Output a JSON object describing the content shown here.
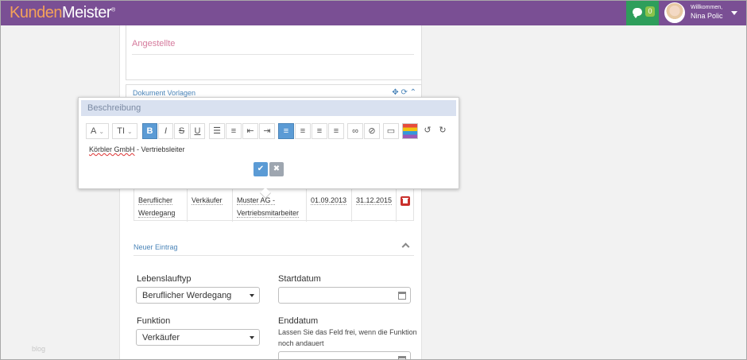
{
  "header": {
    "brand_part1": "Kunden",
    "brand_part2": "Meister",
    "brand_mark": "®",
    "chat_count": "0",
    "welcome": "Willkommen,",
    "username": "Nina Polic"
  },
  "sidebar": {
    "label": "blog"
  },
  "form_top": {
    "field_value": "Angestellte"
  },
  "doc_panel": {
    "title": "Dokument Vorlagen"
  },
  "modal": {
    "title": "Beschreibung",
    "content_company": "Körbler GmbH",
    "content_rest": " - Vertriebsleiter",
    "ok_icon": "✔",
    "cancel_icon": "✖"
  },
  "career_table": {
    "row": {
      "type": "Beruflicher Werdegang",
      "function": "Verkäufer",
      "company": "Muster AG - Vertriebsmitarbeiter",
      "start": "01.09.2013",
      "end": "31.12.2015"
    }
  },
  "new_entry": {
    "title": "Neuer Eintrag",
    "lebenslauftyp_label": "Lebenslauftyp",
    "lebenslauftyp_value": "Beruflicher Werdegang",
    "startdatum_label": "Startdatum",
    "funktion_label": "Funktion",
    "funktion_value": "Verkäufer",
    "enddatum_label": "Enddatum",
    "enddatum_hint": "Lassen Sie das Feld frei, wenn die Funktion noch andauert"
  },
  "colors": {
    "topbar": "#7a4f94",
    "chat_bg": "#2e9e5b",
    "accent_blue": "#5b9bd5",
    "delete_red": "#c9302c"
  }
}
